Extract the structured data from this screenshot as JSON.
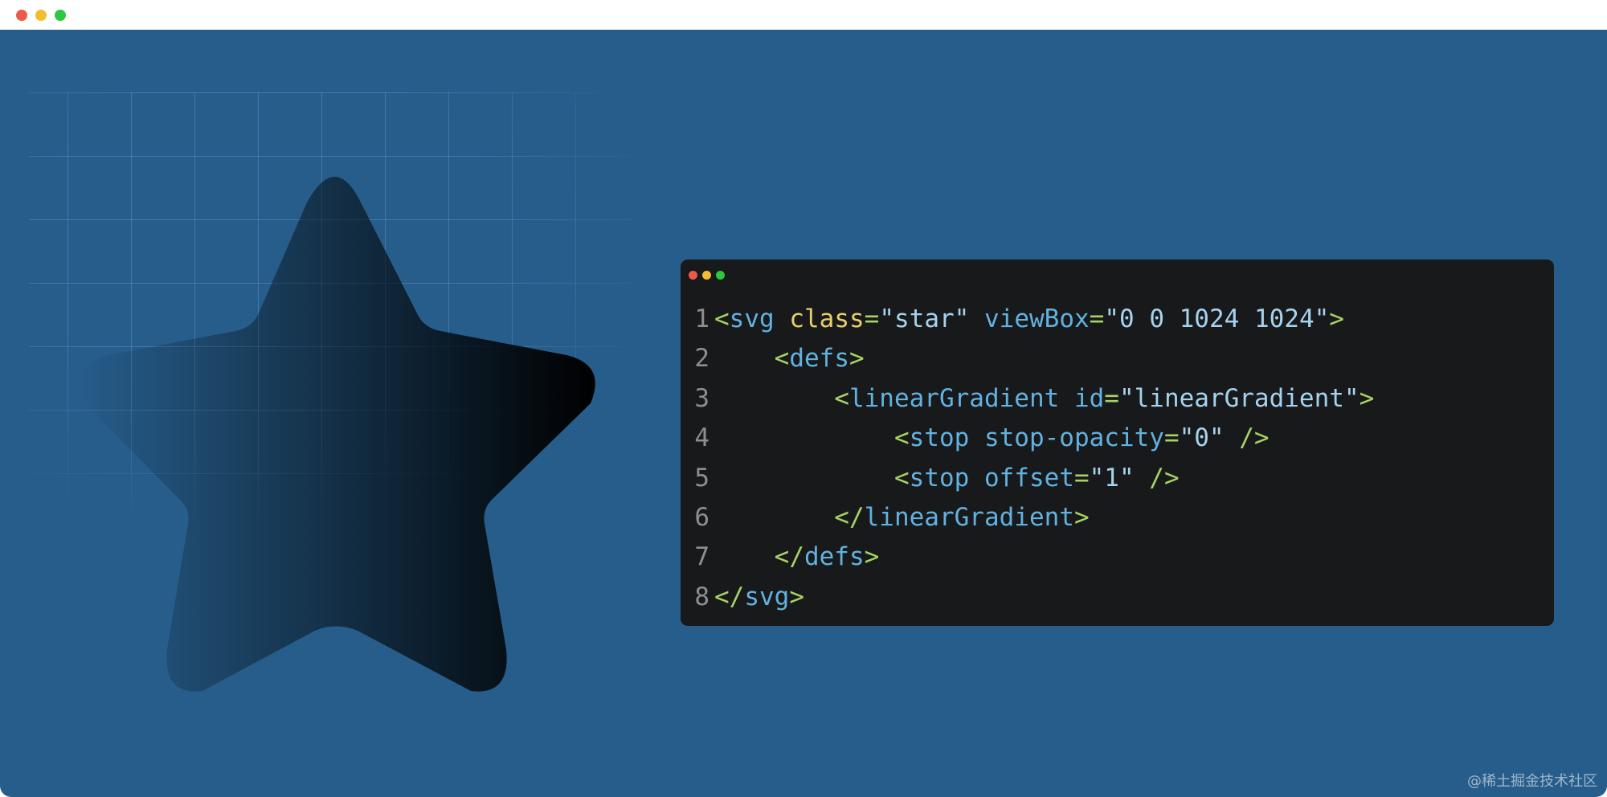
{
  "window": {
    "traffic_lights": [
      {
        "name": "close",
        "color": "#ee5a49"
      },
      {
        "name": "minimize",
        "color": "#f5bc2e"
      },
      {
        "name": "zoom",
        "color": "#2bc840"
      }
    ]
  },
  "canvas": {
    "background": "#265d8b",
    "star": {
      "shape": "rounded five-point star",
      "gradient_start_color": "#000000",
      "gradient_start_opacity": 0,
      "gradient_end_color": "#000000",
      "gradient_end_opacity": 1,
      "direction": "left-to-right"
    }
  },
  "code_window": {
    "background": "#17191b",
    "dots": [
      "#ee5a49",
      "#f5bc2e",
      "#2bc840"
    ],
    "lines": [
      {
        "n": "1",
        "tokens": [
          {
            "t": "<",
            "k": "punct"
          },
          {
            "t": "svg",
            "k": "tag"
          },
          {
            "t": " ",
            "k": "punct"
          },
          {
            "t": "class",
            "k": "attr"
          },
          {
            "t": "=",
            "k": "eq"
          },
          {
            "t": "\"star\"",
            "k": "str"
          },
          {
            "t": " ",
            "k": "punct"
          },
          {
            "t": "viewBox",
            "k": "attr2"
          },
          {
            "t": "=",
            "k": "eq"
          },
          {
            "t": "\"0 0 1024 1024\"",
            "k": "str"
          },
          {
            "t": ">",
            "k": "punct"
          }
        ]
      },
      {
        "n": "2",
        "tokens": [
          {
            "t": "    <",
            "k": "punct"
          },
          {
            "t": "defs",
            "k": "tag"
          },
          {
            "t": ">",
            "k": "punct"
          }
        ]
      },
      {
        "n": "3",
        "tokens": [
          {
            "t": "        <",
            "k": "punct"
          },
          {
            "t": "linearGradient",
            "k": "tag"
          },
          {
            "t": " ",
            "k": "punct"
          },
          {
            "t": "id",
            "k": "attr2"
          },
          {
            "t": "=",
            "k": "eq"
          },
          {
            "t": "\"linearGradient\"",
            "k": "str"
          },
          {
            "t": ">",
            "k": "punct"
          }
        ]
      },
      {
        "n": "4",
        "tokens": [
          {
            "t": "            <",
            "k": "punct"
          },
          {
            "t": "stop",
            "k": "tag"
          },
          {
            "t": " ",
            "k": "punct"
          },
          {
            "t": "stop-opacity",
            "k": "attr2"
          },
          {
            "t": "=",
            "k": "eq"
          },
          {
            "t": "\"0\"",
            "k": "str"
          },
          {
            "t": " />",
            "k": "punct"
          }
        ]
      },
      {
        "n": "5",
        "tokens": [
          {
            "t": "            <",
            "k": "punct"
          },
          {
            "t": "stop",
            "k": "tag"
          },
          {
            "t": " ",
            "k": "punct"
          },
          {
            "t": "offset",
            "k": "attr2"
          },
          {
            "t": "=",
            "k": "eq"
          },
          {
            "t": "\"1\"",
            "k": "str"
          },
          {
            "t": " />",
            "k": "punct"
          }
        ]
      },
      {
        "n": "6",
        "tokens": [
          {
            "t": "        </",
            "k": "punct"
          },
          {
            "t": "linearGradient",
            "k": "tag"
          },
          {
            "t": ">",
            "k": "punct"
          }
        ]
      },
      {
        "n": "7",
        "tokens": [
          {
            "t": "    </",
            "k": "punct"
          },
          {
            "t": "defs",
            "k": "tag"
          },
          {
            "t": ">",
            "k": "punct"
          }
        ]
      },
      {
        "n": "8",
        "tokens": [
          {
            "t": "</",
            "k": "punct"
          },
          {
            "t": "svg",
            "k": "tag"
          },
          {
            "t": ">",
            "k": "punct"
          }
        ]
      }
    ]
  },
  "watermark": "@稀土掘金技术社区"
}
